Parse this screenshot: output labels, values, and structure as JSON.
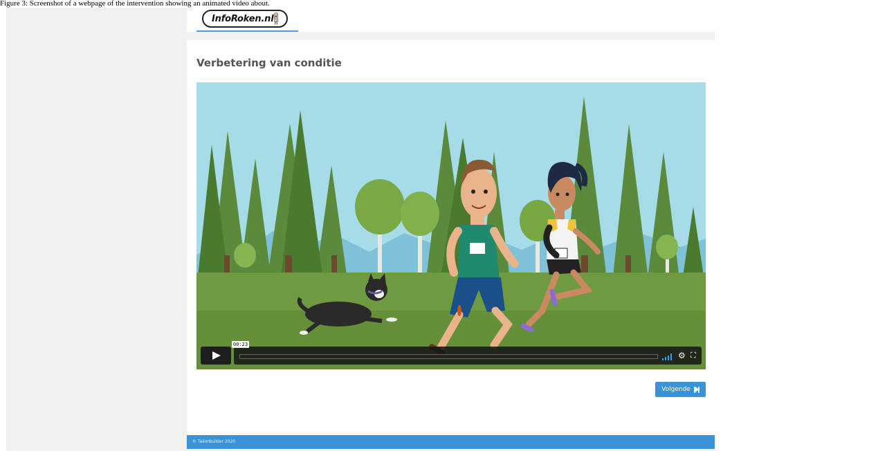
{
  "caption": "Figure 3: Screenshot of a webpage of the intervention showing an animated video about.",
  "header": {
    "logo_text": "InfoRoken.nl"
  },
  "main": {
    "title": "Verbetering van conditie",
    "video": {
      "current_time": "00:23",
      "progress": 0.0
    },
    "next_button_label": "Volgende"
  },
  "footer": {
    "text": "© TailorBuilder 2020"
  },
  "colors": {
    "accent": "#3a93d6",
    "page_bg": "#f1f1f1"
  },
  "icons": [
    "play-icon",
    "volume-icon",
    "settings-gear-icon",
    "fullscreen-icon",
    "next-icon"
  ]
}
